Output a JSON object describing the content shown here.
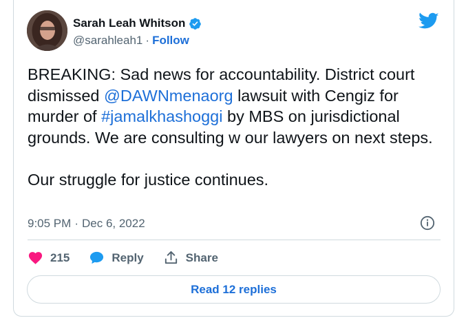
{
  "author": {
    "name": "Sarah Leah Whitson",
    "handle": "@sarahleah1",
    "separator": "·",
    "follow_label": "Follow"
  },
  "tweet": {
    "segments_line1": [
      {
        "text": "BREAKING: Sad news for accountability. District court dismissed ",
        "link": false
      },
      {
        "text": "@DAWNmenaorg",
        "link": true
      },
      {
        "text": " lawsuit with Cengiz for murder of ",
        "link": false
      },
      {
        "text": "#jamalkhashoggi",
        "link": true
      },
      {
        "text": " by MBS on jurisdictional grounds. We are consulting w our lawyers on next steps.",
        "link": false
      }
    ],
    "paragraph2": "Our struggle for justice continues."
  },
  "meta": {
    "time": "9:05 PM",
    "separator": "·",
    "date": "Dec 6, 2022"
  },
  "actions": {
    "like_count": "215",
    "reply_label": "Reply",
    "share_label": "Share"
  },
  "replies_button": "Read 12 replies",
  "colors": {
    "accent": "#1d9bf0",
    "link": "#1d6fd8",
    "like": "#f91880",
    "muted": "#536471"
  },
  "icons": {
    "logo": "twitter-bird-icon",
    "verified": "verified-badge-icon",
    "info": "info-icon",
    "like": "heart-icon",
    "reply": "speech-bubble-icon",
    "share": "share-upload-icon"
  }
}
